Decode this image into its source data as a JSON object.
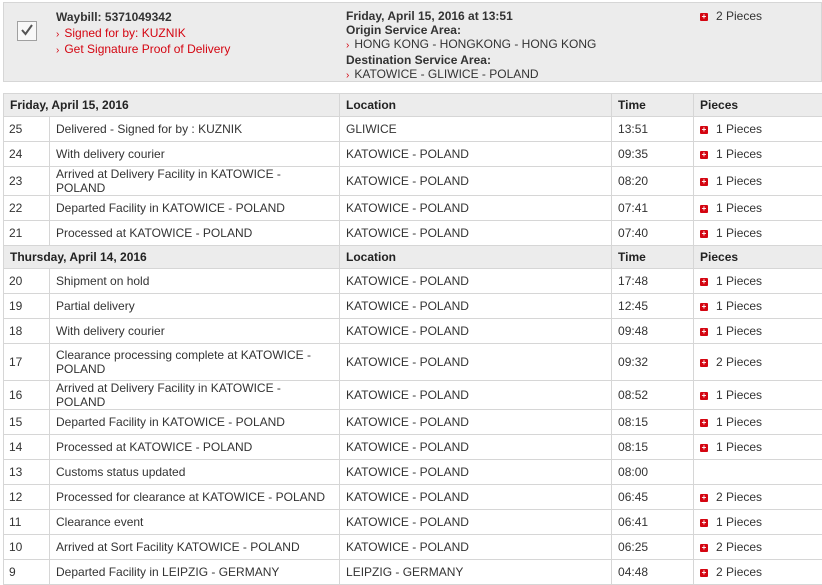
{
  "summary": {
    "waybill": "Waybill: 5371049342",
    "signed_by": "Signed for by: KUZNIK",
    "proof_link": "Get Signature Proof of Delivery",
    "date": "Friday, April 15, 2016 at 13:51",
    "origin_label": "Origin Service Area:",
    "origin": "HONG KONG - HONGKONG - HONG KONG",
    "dest_label": "Destination Service Area:",
    "destination": "KATOWICE - GLIWICE - POLAND",
    "pieces": "2 Pieces"
  },
  "groups": [
    {
      "date": "Friday, April 15, 2016",
      "headers": [
        "Location",
        "Time",
        "Pieces"
      ],
      "rows": [
        {
          "num": "25",
          "event": "Delivered - Signed for by : KUZNIK",
          "location": "GLIWICE",
          "time": "13:51",
          "pieces": "1 Pieces"
        },
        {
          "num": "24",
          "event": "With delivery courier",
          "location": "KATOWICE - POLAND",
          "time": "09:35",
          "pieces": "1 Pieces"
        },
        {
          "num": "23",
          "event": "Arrived at Delivery Facility in KATOWICE - POLAND",
          "location": "KATOWICE - POLAND",
          "time": "08:20",
          "pieces": "1 Pieces"
        },
        {
          "num": "22",
          "event": "Departed Facility in KATOWICE - POLAND",
          "location": "KATOWICE - POLAND",
          "time": "07:41",
          "pieces": "1 Pieces"
        },
        {
          "num": "21",
          "event": "Processed at KATOWICE - POLAND",
          "location": "KATOWICE - POLAND",
          "time": "07:40",
          "pieces": "1 Pieces"
        }
      ]
    },
    {
      "date": "Thursday, April 14, 2016",
      "headers": [
        "Location",
        "Time",
        "Pieces"
      ],
      "rows": [
        {
          "num": "20",
          "event": "Shipment on hold",
          "location": "KATOWICE - POLAND",
          "time": "17:48",
          "pieces": "1 Pieces"
        },
        {
          "num": "19",
          "event": "Partial delivery",
          "location": "KATOWICE - POLAND",
          "time": "12:45",
          "pieces": "1 Pieces"
        },
        {
          "num": "18",
          "event": "With delivery courier",
          "location": "KATOWICE - POLAND",
          "time": "09:48",
          "pieces": "1 Pieces"
        },
        {
          "num": "17",
          "event": "Clearance processing complete at KATOWICE - POLAND",
          "location": "KATOWICE - POLAND",
          "time": "09:32",
          "pieces": "2 Pieces",
          "tall": true
        },
        {
          "num": "16",
          "event": "Arrived at Delivery Facility in KATOWICE - POLAND",
          "location": "KATOWICE - POLAND",
          "time": "08:52",
          "pieces": "1 Pieces"
        },
        {
          "num": "15",
          "event": "Departed Facility in KATOWICE - POLAND",
          "location": "KATOWICE - POLAND",
          "time": "08:15",
          "pieces": "1 Pieces"
        },
        {
          "num": "14",
          "event": "Processed at KATOWICE - POLAND",
          "location": "KATOWICE - POLAND",
          "time": "08:15",
          "pieces": "1 Pieces"
        },
        {
          "num": "13",
          "event": "Customs status updated",
          "location": "KATOWICE - POLAND",
          "time": "08:00",
          "pieces": ""
        },
        {
          "num": "12",
          "event": "Processed for clearance at KATOWICE - POLAND",
          "location": "KATOWICE - POLAND",
          "time": "06:45",
          "pieces": "2 Pieces"
        },
        {
          "num": "11",
          "event": "Clearance event",
          "location": "KATOWICE - POLAND",
          "time": "06:41",
          "pieces": "1 Pieces"
        },
        {
          "num": "10",
          "event": "Arrived at Sort Facility KATOWICE - POLAND",
          "location": "KATOWICE - POLAND",
          "time": "06:25",
          "pieces": "2 Pieces"
        },
        {
          "num": "9",
          "event": "Departed Facility in LEIPZIG - GERMANY",
          "location": "LEIPZIG - GERMANY",
          "time": "04:48",
          "pieces": "2 Pieces"
        }
      ]
    }
  ],
  "icons": {
    "checkbox": "checkmark-icon",
    "expand": "plus-icon",
    "link": "chevron-right-icon"
  },
  "colors": {
    "accent": "#d40511",
    "header_bg": "#ececec"
  }
}
